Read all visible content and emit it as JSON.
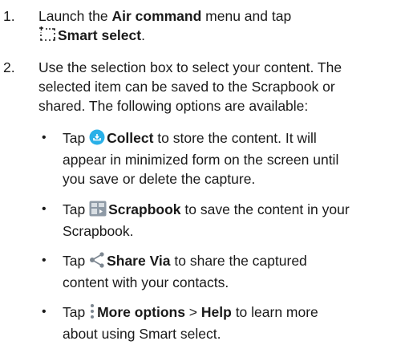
{
  "steps": [
    {
      "number": "1.",
      "line1_pre": "Launch the ",
      "line1_bold": "Air command",
      "line1_post": " menu and tap",
      "line2_bold": "Smart select",
      "line2_post": "."
    },
    {
      "number": "2.",
      "lines": [
        "Use the selection box to select your content. The",
        "selected item can be saved to the Scrapbook or",
        "shared. The following options are available:"
      ]
    }
  ],
  "bullets": [
    {
      "dot": "•",
      "pre": "Tap ",
      "bold": "Collect",
      "post": " to store the content. It will",
      "line2": "appear in minimized form on the screen until",
      "line3": "you save or delete the capture."
    },
    {
      "dot": "•",
      "pre": "Tap ",
      "bold": "Scrapbook",
      "post": " to save the content in your",
      "line2": "Scrapbook."
    },
    {
      "dot": "•",
      "pre": "Tap ",
      "bold": "Share Via",
      "post": " to share the captured",
      "line2": "content with your contacts."
    },
    {
      "dot": "•",
      "pre": "Tap ",
      "bold": "More options",
      "mid": " > ",
      "bold2": "Help",
      "post": " to learn more",
      "line2": "about using Smart select."
    }
  ],
  "icons": {
    "smart_select": "smart-select-icon",
    "collect": "collect-icon",
    "scrapbook": "scrapbook-icon",
    "share": "share-icon",
    "more_options": "more-options-icon"
  },
  "colors": {
    "text": "#1a1a1a",
    "collect_icon": "#29b0e8",
    "scrapbook_icon": "#8e9aa6",
    "share_icon": "#7d8791"
  }
}
